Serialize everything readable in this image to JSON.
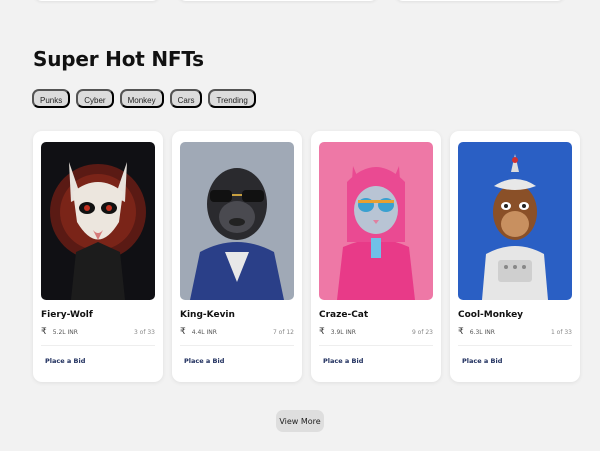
{
  "section": {
    "title": "Super Hot NFTs"
  },
  "filters": [
    "Punks",
    "Cyber",
    "Monkey",
    "Cars",
    "Trending"
  ],
  "cards": [
    {
      "name": "Fiery-Wolf",
      "price": "5.2L INR",
      "edition": "3 of 33",
      "action": "Place a Bid",
      "image_bg": "#101014",
      "image": "wolf-artwork"
    },
    {
      "name": "King-Kevin",
      "price": "4.4L INR",
      "edition": "7 of 12",
      "action": "Place a Bid",
      "image_bg": "#9aa4b2",
      "image": "gorilla-artwork"
    },
    {
      "name": "Craze-Cat",
      "price": "3.9L INR",
      "edition": "9 of 23",
      "action": "Place a Bid",
      "image_bg": "#f07aa8",
      "image": "cat-artwork"
    },
    {
      "name": "Cool-Monkey",
      "price": "6.3L INR",
      "edition": "1 of 33",
      "action": "Place a Bid",
      "image_bg": "#2a5fc4",
      "image": "monkey-artwork"
    }
  ],
  "currency_symbol": "₹",
  "view_more_label": "View More"
}
